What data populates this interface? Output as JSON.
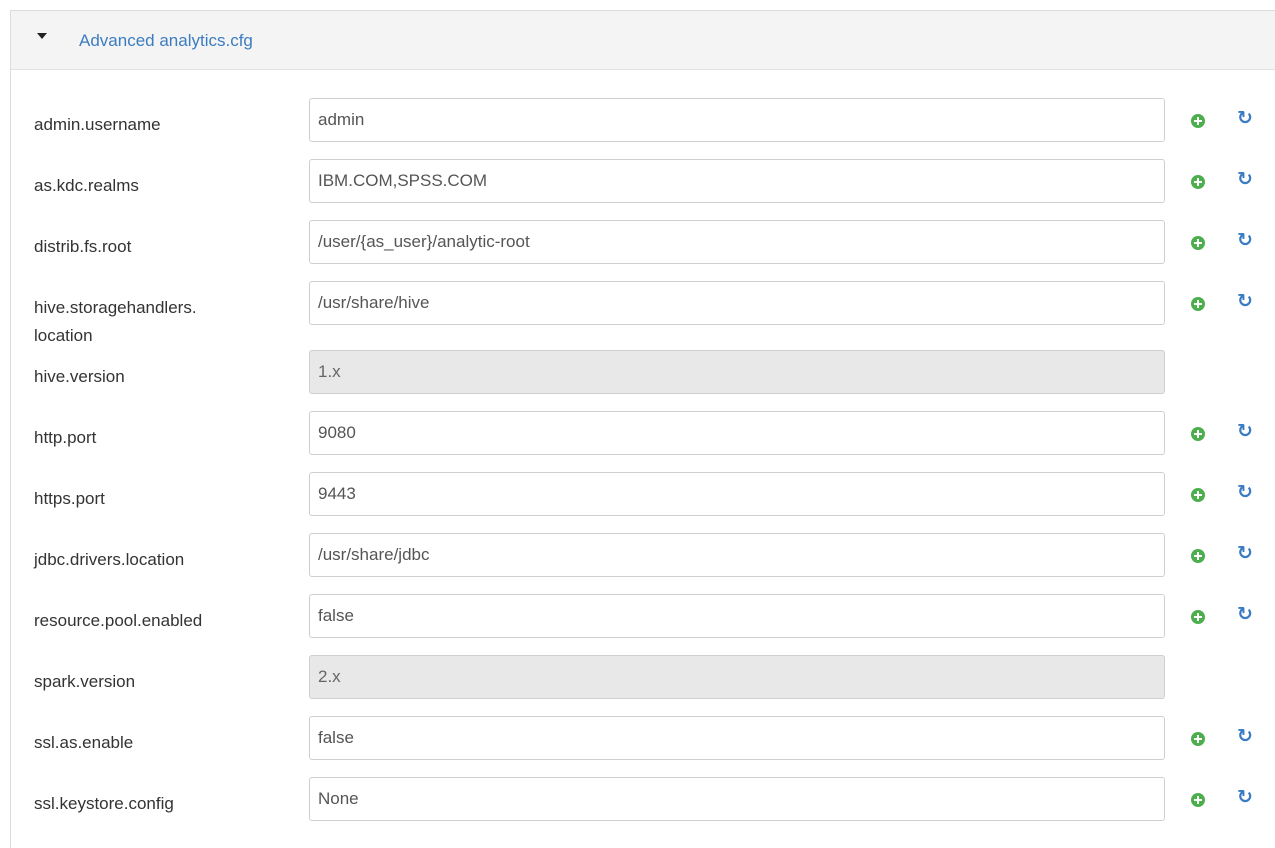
{
  "section": {
    "title": "Advanced analytics.cfg"
  },
  "properties": [
    {
      "label": "admin.username",
      "value": "admin",
      "readonly": false
    },
    {
      "label": "as.kdc.realms",
      "value": "IBM.COM,SPSS.COM",
      "readonly": false
    },
    {
      "label": "distrib.fs.root",
      "value": "/user/{as_user}/analytic-root",
      "readonly": false
    },
    {
      "label": "hive.storagehandlers.\nlocation",
      "value": "/usr/share/hive",
      "readonly": false
    },
    {
      "label": "hive.version",
      "value": "1.x",
      "readonly": true
    },
    {
      "label": "http.port",
      "value": "9080",
      "readonly": false
    },
    {
      "label": "https.port",
      "value": "9443",
      "readonly": false
    },
    {
      "label": "jdbc.drivers.location",
      "value": "/usr/share/jdbc",
      "readonly": false
    },
    {
      "label": "resource.pool.enabled",
      "value": "false",
      "readonly": false
    },
    {
      "label": "spark.version",
      "value": "2.x",
      "readonly": true
    },
    {
      "label": "ssl.as.enable",
      "value": "false",
      "readonly": false
    },
    {
      "label": "ssl.keystore.config",
      "value": "None",
      "readonly": false
    }
  ],
  "icons": {
    "add": "plus-circle-icon",
    "reset": "refresh-icon",
    "collapse": "caret-down-icon"
  },
  "colors": {
    "title": "#3c7cc0",
    "add": "#4cae4c",
    "reset": "#3a7cc4",
    "readonly_bg": "#e8e8e8"
  }
}
